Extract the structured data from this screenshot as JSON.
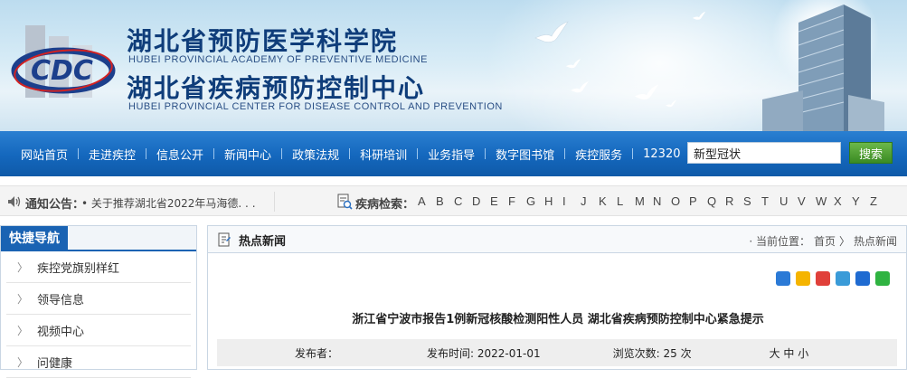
{
  "header": {
    "org_cn_1": "湖北省预防医学科学院",
    "org_en_1": "HUBEI PROVINCIAL ACADEMY OF PREVENTIVE MEDICINE",
    "org_cn_2": "湖北省疾病预防控制中心",
    "org_en_2": "HUBEI PROVINCIAL CENTER FOR DISEASE CONTROL AND PREVENTION",
    "logo_text": "CDC"
  },
  "nav": {
    "items": [
      "网站首页",
      "走进疾控",
      "信息公开",
      "新闻中心",
      "政策法规",
      "科研培训",
      "业务指导",
      "数字图书馆",
      "疾控服务",
      "12320"
    ],
    "search_value": "新型冠状",
    "search_button": "搜索"
  },
  "notice": {
    "label": "通知公告：",
    "text": "• 关于推荐湖北省2022年马海德. . .",
    "disease_label": "疾病检索：",
    "letters": [
      "A",
      "B",
      "C",
      "D",
      "E",
      "F",
      "G",
      "H",
      "I",
      "J",
      "K",
      "L",
      "M",
      "N",
      "O",
      "P",
      "Q",
      "R",
      "S",
      "T",
      "U",
      "V",
      "W",
      "X",
      "Y",
      "Z"
    ]
  },
  "sidebar": {
    "title": "快捷导航",
    "items": [
      "疾控党旗别样红",
      "领导信息",
      "视频中心",
      "问健康"
    ]
  },
  "main": {
    "section_title": "热点新闻",
    "breadcrumb": {
      "prefix": "· 当前位置：",
      "home": "首页",
      "sep": "〉",
      "current": "热点新闻"
    },
    "article_title": "浙江省宁波市报告1例新冠核酸检测阳性人员 湖北省疾病预防控制中心紧急提示",
    "meta": {
      "publisher": "发布者：",
      "date": "发布时间: 2022-01-01",
      "views": "浏览次数: 25 次",
      "font_size": "大 中 小"
    }
  },
  "colors": {
    "nav_blue": "#1467bd",
    "sidebar_title_bg": "#1a63b3",
    "search_green": "#3a8b23",
    "title_navy": "#0f3d7a"
  }
}
